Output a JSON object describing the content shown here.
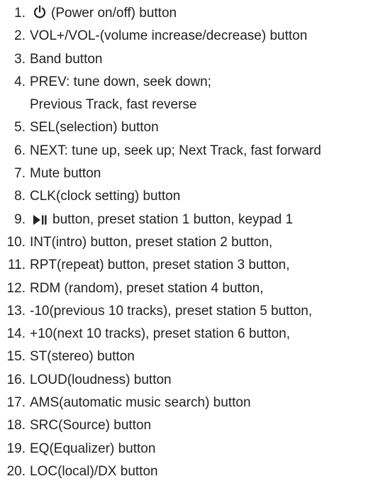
{
  "items": [
    {
      "number": "1.",
      "text": "(Power on/off) button",
      "icon": "power-icon"
    },
    {
      "number": "2.",
      "text": "VOL+/VOL-(volume increase/decrease) button"
    },
    {
      "number": "3.",
      "text": "Band button"
    },
    {
      "number": "4.",
      "text": "PREV: tune down, seek down;",
      "text2": "Previous Track, fast reverse"
    },
    {
      "number": "5.",
      "text": "SEL(selection) button"
    },
    {
      "number": "6.",
      "text": "NEXT: tune up, seek up; Next Track, fast forward"
    },
    {
      "number": "7.",
      "text": "Mute button"
    },
    {
      "number": "8.",
      "text": "CLK(clock setting) button"
    },
    {
      "number": "9.",
      "text": "button, preset station 1 button, keypad 1",
      "icon": "play-pause-icon"
    },
    {
      "number": "10.",
      "text": "INT(intro) button, preset station 2 button,"
    },
    {
      "number": "11.",
      "text": "RPT(repeat) button, preset station 3 button,"
    },
    {
      "number": "12.",
      "text": "RDM (random), preset station 4 button,"
    },
    {
      "number": "13.",
      "text": "-10(previous 10 tracks), preset station 5 button,"
    },
    {
      "number": "14.",
      "text": "+10(next 10 tracks), preset station 6 button,"
    },
    {
      "number": "15.",
      "text": "ST(stereo) button"
    },
    {
      "number": "16.",
      "text": "LOUD(loudness) button"
    },
    {
      "number": "17.",
      "text": "AMS(automatic music search) button"
    },
    {
      "number": "18.",
      "text": "SRC(Source) button"
    },
    {
      "number": "19.",
      "text": "EQ(Equalizer) button"
    },
    {
      "number": "20.",
      "text": "LOC(local)/DX button"
    }
  ]
}
